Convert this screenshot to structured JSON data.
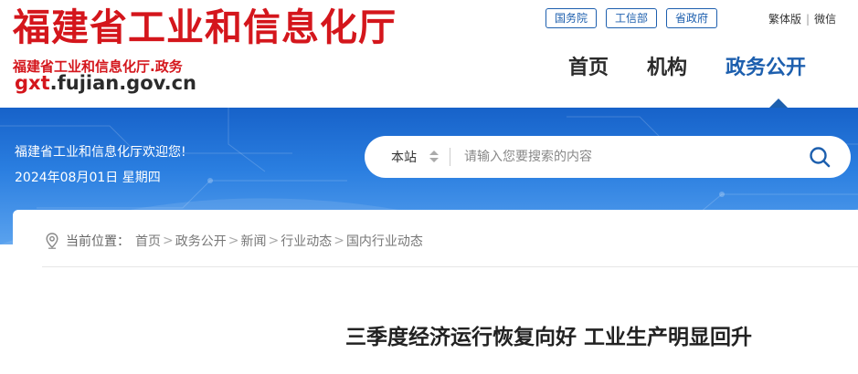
{
  "header": {
    "logo_title": "福建省工业和信息化厅",
    "logo_subtitle": "福建省工业和信息化厅.政务",
    "logo_domain_prefix": "gxt",
    "logo_domain_rest": ".fujian.gov.cn",
    "top_links": [
      "国务院",
      "工信部",
      "省政府"
    ],
    "utils": {
      "traditional": "繁体版",
      "divider": "|",
      "wechat": "微信"
    },
    "nav": [
      "首页",
      "机构",
      "政务公开"
    ]
  },
  "banner": {
    "welcome": "福建省工业和信息化厅欢迎您!",
    "date": "2024年08月01日 星期四"
  },
  "search": {
    "scope": "本站",
    "placeholder": "请输入您要搜索的内容",
    "icon": "search-icon"
  },
  "breadcrumb": {
    "label": "当前位置：",
    "items": [
      "首页",
      "政务公开",
      "新闻",
      "行业动态",
      "国内行业动态"
    ],
    "separator": ">"
  },
  "article": {
    "title": "三季度经济运行恢复向好 工业生产明显回升"
  },
  "colors": {
    "brand_red": "#d4161c",
    "brand_blue": "#1d5fae",
    "banner_blue": "#2a7ee0"
  }
}
